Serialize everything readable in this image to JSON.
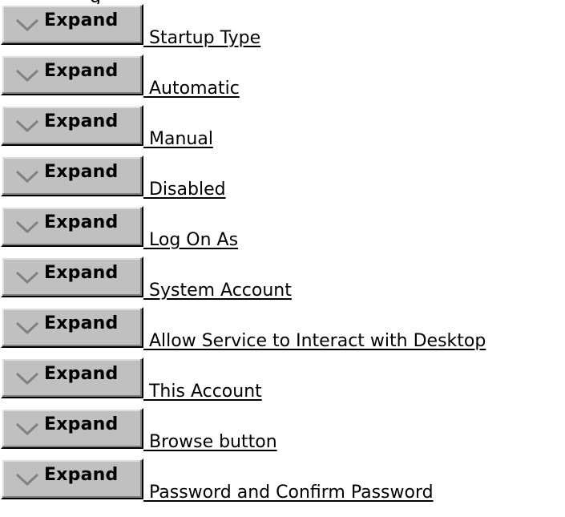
{
  "topics": [
    {
      "button_label": "Expand",
      "title": " Startup Type"
    },
    {
      "button_label": "Expand",
      "title": " Automatic"
    },
    {
      "button_label": "Expand",
      "title": " Manual"
    },
    {
      "button_label": "Expand",
      "title": " Disabled"
    },
    {
      "button_label": "Expand",
      "title": " Log On As"
    },
    {
      "button_label": "Expand",
      "title": " System Account"
    },
    {
      "button_label": "Expand",
      "title": " Allow Service to Interact with Desktop"
    },
    {
      "button_label": "Expand",
      "title": " This Account"
    },
    {
      "button_label": "Expand",
      "title": " Browse button"
    },
    {
      "button_label": "Expand",
      "title": " Password and Confirm Password"
    }
  ],
  "icons": {
    "expand": "chevron-down-icon"
  },
  "colors": {
    "button_face": "#c0c0c0",
    "chevron": "#808080",
    "link_text": "#000000",
    "background": "#ffffff"
  }
}
